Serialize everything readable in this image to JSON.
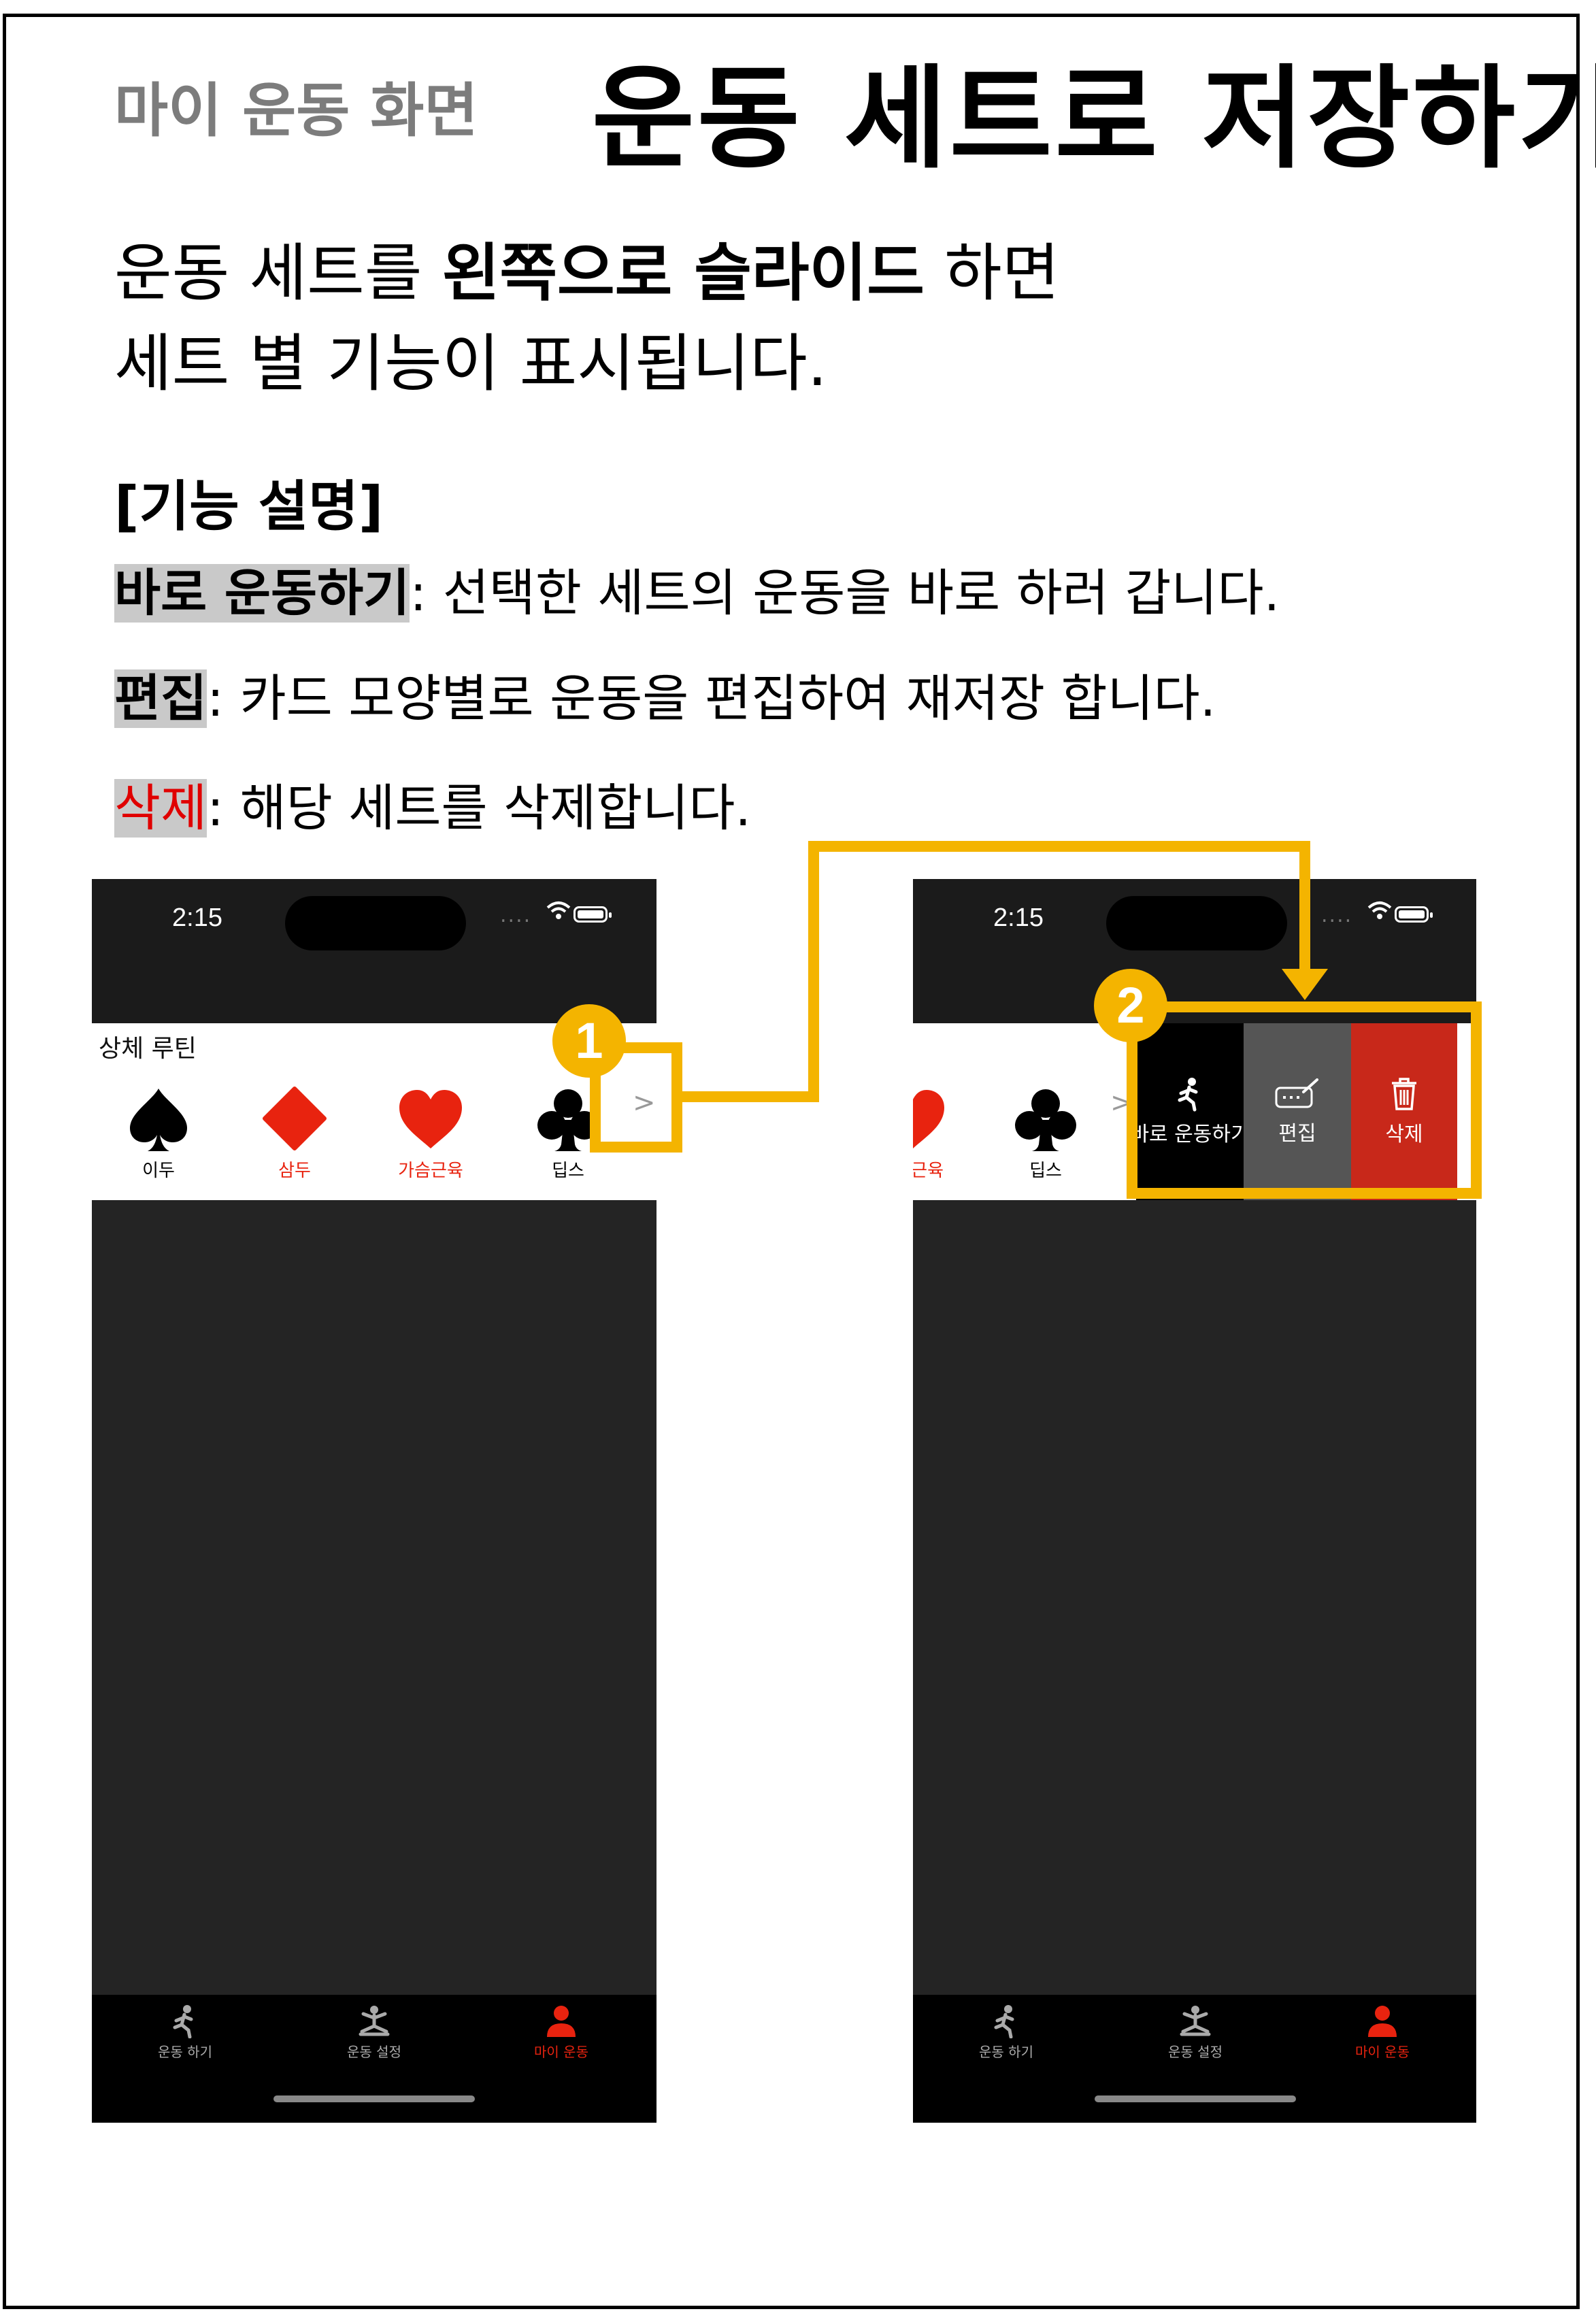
{
  "header": {
    "subtitle": "마이 운동 화면",
    "title": "운동 세트로 저장하기"
  },
  "intro": {
    "line1_a": "운동 세트를 ",
    "line1_bold": "왼쪽으로 슬라이드",
    "line1_b": " 하면",
    "line2": "세트 별 기능이 표시됩니다."
  },
  "features": {
    "section_title": "[기능 설명]",
    "items": [
      {
        "key": "바로 운동하기",
        "desc": ": 선택한 세트의 운동을 바로 하러 갑니다."
      },
      {
        "key": "편집",
        "desc": ": 카드 모양별로 운동을 편집하여 재저장 합니다."
      },
      {
        "key": "삭제",
        "desc": ": 해당 세트를 삭제합니다."
      }
    ]
  },
  "phone": {
    "time": "2:15",
    "dots": "....",
    "routine_title": "상체  루틴",
    "cards": [
      {
        "label": "이두",
        "suit": "spade",
        "color": "#000000"
      },
      {
        "label": "삼두",
        "suit": "diamond",
        "color": "#e8230f"
      },
      {
        "label": "가슴근육",
        "suit": "heart",
        "color": "#e8230f"
      },
      {
        "label": "딥스",
        "suit": "club",
        "color": "#000000"
      }
    ],
    "chevron": ">",
    "partial_label": "근육",
    "actions": {
      "workout": "바로 운동하기",
      "edit": "편집",
      "delete": "삭제"
    },
    "action_colors": {
      "workout": "#000000",
      "edit": "#555555",
      "delete": "#c8281a"
    },
    "tabs": [
      "운동 하기",
      "운동 설정",
      "마이 운동"
    ]
  },
  "badges": [
    "1",
    "2"
  ],
  "colors": {
    "highlight": "#f4b400",
    "accent_red": "#e00000"
  }
}
